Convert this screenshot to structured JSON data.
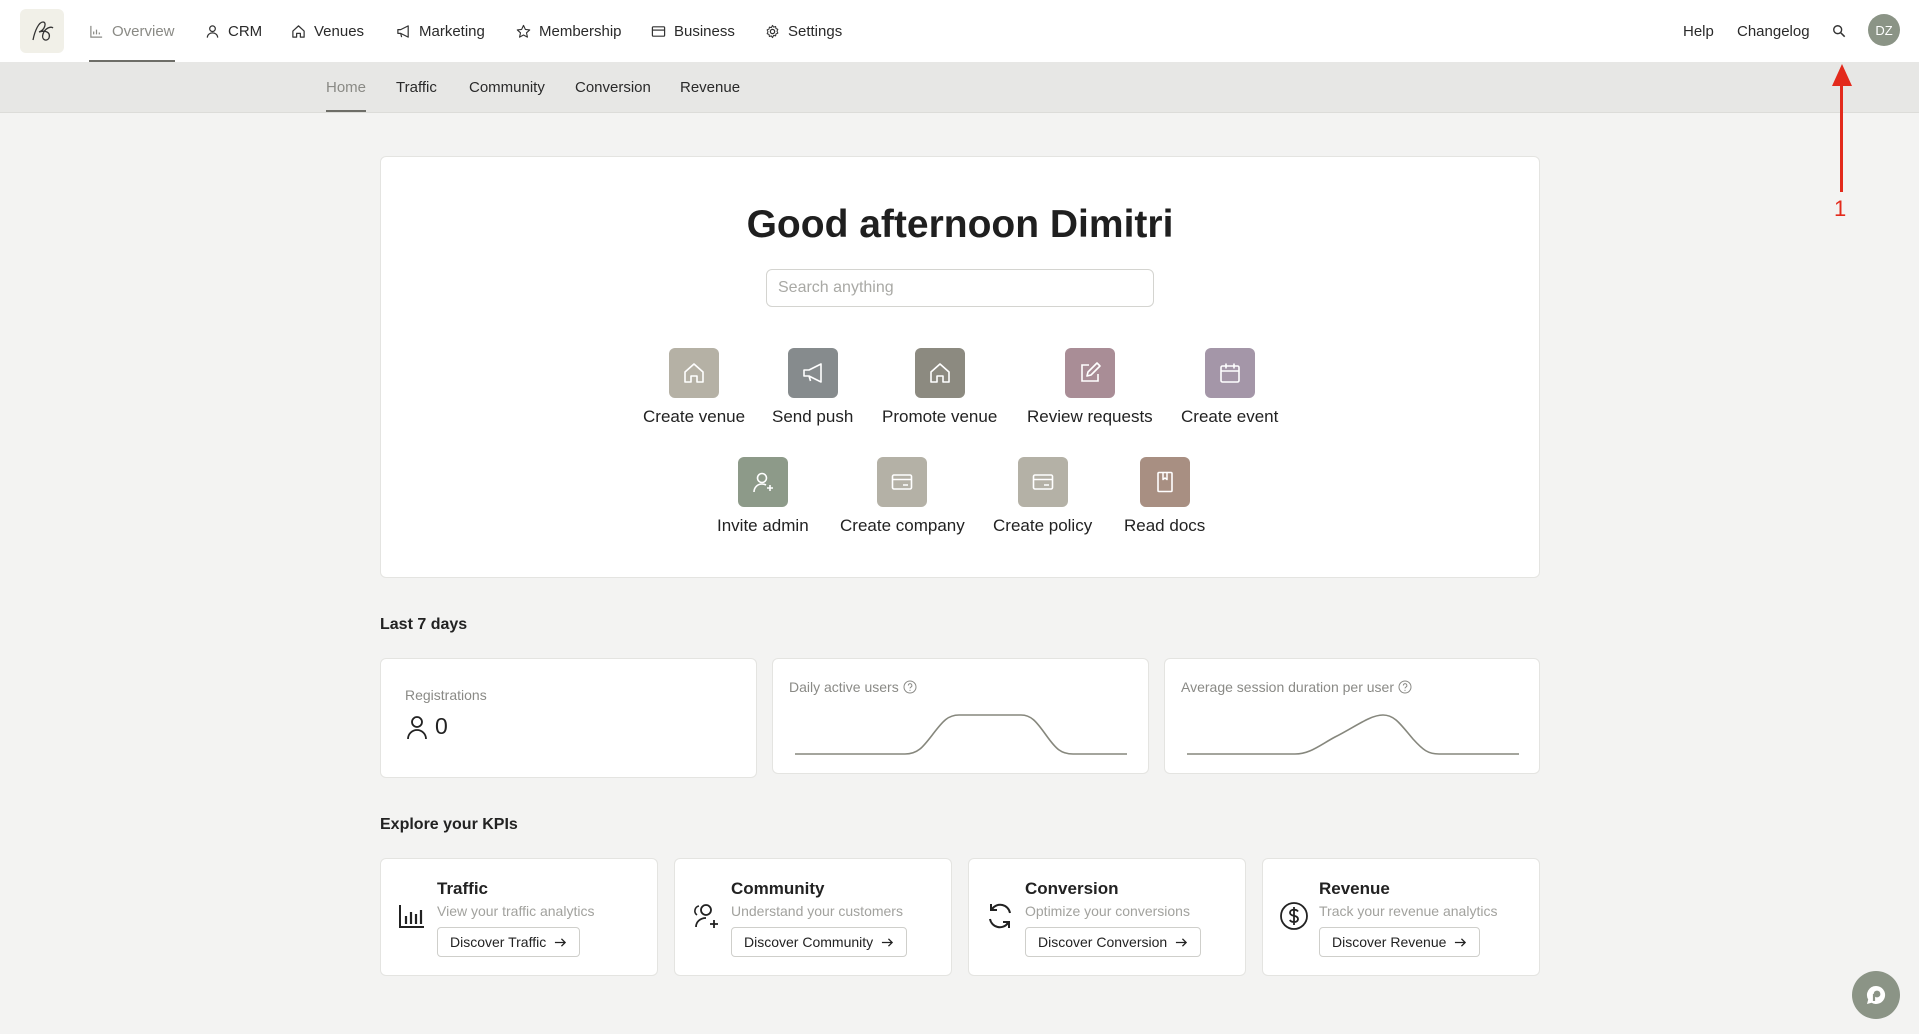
{
  "nav": {
    "items": [
      {
        "label": "Overview",
        "icon": "bar-chart-icon"
      },
      {
        "label": "CRM",
        "icon": "user-icon"
      },
      {
        "label": "Venues",
        "icon": "home-icon"
      },
      {
        "label": "Marketing",
        "icon": "megaphone-icon"
      },
      {
        "label": "Membership",
        "icon": "star-icon"
      },
      {
        "label": "Business",
        "icon": "card-icon"
      },
      {
        "label": "Settings",
        "icon": "gear-icon"
      }
    ],
    "help": "Help",
    "changelog": "Changelog",
    "avatar_initials": "DZ"
  },
  "subnav": {
    "items": [
      "Home",
      "Traffic",
      "Community",
      "Conversion",
      "Revenue"
    ]
  },
  "hero": {
    "greeting": "Good afternoon Dimitri",
    "search_placeholder": "Search anything",
    "actions": [
      {
        "label": "Create venue",
        "icon": "home-icon",
        "color": "#b5b1a5"
      },
      {
        "label": "Send push",
        "icon": "megaphone-icon",
        "color": "#868b8d"
      },
      {
        "label": "Promote venue",
        "icon": "home-icon",
        "color": "#8c8a80"
      },
      {
        "label": "Review requests",
        "icon": "edit-icon",
        "color": "#a98d96"
      },
      {
        "label": "Create event",
        "icon": "calendar-icon",
        "color": "#a496a8"
      },
      {
        "label": "Invite admin",
        "icon": "user-plus-icon",
        "color": "#8d9a89"
      },
      {
        "label": "Create company",
        "icon": "card-icon",
        "color": "#b4b1a6"
      },
      {
        "label": "Create policy",
        "icon": "card-icon",
        "color": "#b4b1a6"
      },
      {
        "label": "Read docs",
        "icon": "book-icon",
        "color": "#a88f82"
      }
    ]
  },
  "last7": {
    "title": "Last 7 days",
    "registrations_label": "Registrations",
    "registrations_value": "0",
    "dau_label": "Daily active users",
    "session_label": "Average session duration per user"
  },
  "kpis": {
    "title": "Explore your KPIs",
    "cards": [
      {
        "title": "Traffic",
        "subtitle": "View your traffic analytics",
        "button": "Discover Traffic",
        "icon": "bar-chart-icon"
      },
      {
        "title": "Community",
        "subtitle": "Understand your customers",
        "button": "Discover Community",
        "icon": "users-icon"
      },
      {
        "title": "Conversion",
        "subtitle": "Optimize your conversions",
        "button": "Discover Conversion",
        "icon": "refresh-icon"
      },
      {
        "title": "Revenue",
        "subtitle": "Track your revenue analytics",
        "button": "Discover Revenue",
        "icon": "dollar-icon"
      }
    ]
  },
  "annotation": {
    "number": "1"
  }
}
